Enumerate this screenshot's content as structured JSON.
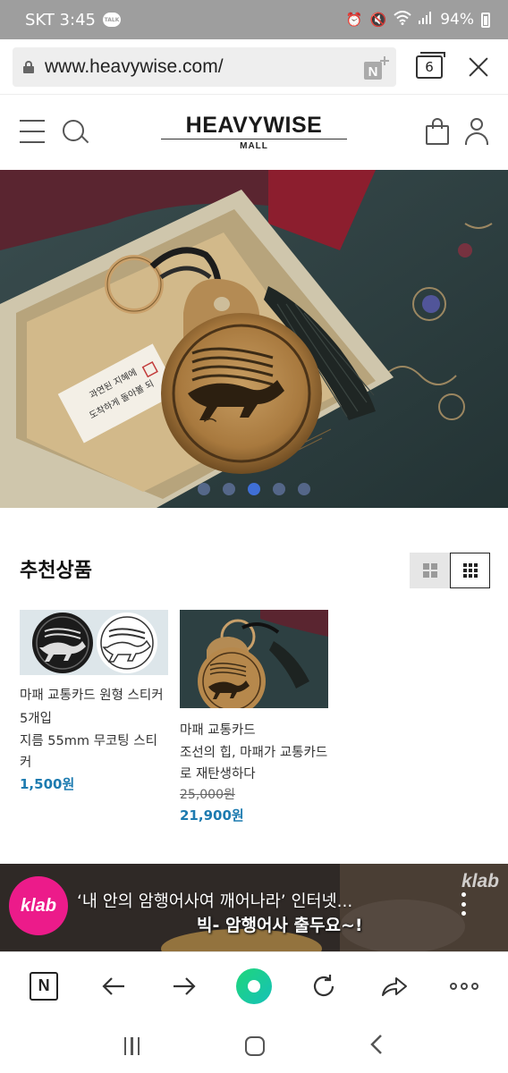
{
  "status_bar": {
    "carrier_time": "SKT 3:45",
    "talk_badge": "TALK",
    "battery": "94%"
  },
  "browser": {
    "url": "www.heavywise.com/",
    "naver_add_label": "N",
    "tab_count": "6"
  },
  "site": {
    "logo_main": "HEAVYWISE",
    "logo_sub": "MALL"
  },
  "hero": {
    "slide_count": 5,
    "active_slide": 3,
    "note_text_line1": "과연된 지혜에",
    "note_text_line2": "도착하게 돌아볼 되"
  },
  "recommended": {
    "title": "추천상품",
    "products": [
      {
        "name": "마패 교통카드 원형 스티커 5개입",
        "desc": "지름 55mm 무코팅 스티커",
        "original_price": "",
        "price": "1,500원"
      },
      {
        "name": "마패 교통카드",
        "desc": "조선의 힙, 마패가 교통카드로 재탄생하다",
        "original_price": "25,000원",
        "price": "21,900원"
      }
    ]
  },
  "video": {
    "channel_logo": "klab",
    "corner_logo": "klab",
    "title": "‘내 안의 암행어사여 깨어나라’ 인터넷...",
    "subtitle": "빅- 암행어사 출두요~!"
  },
  "toolbar": {
    "naver_label": "N"
  },
  "colors": {
    "accent_price": "#1d7bb0",
    "klab_pink": "#ec1b8a",
    "status_bar": "#9e9e9e",
    "carousel_active": "#3f6fd6"
  }
}
